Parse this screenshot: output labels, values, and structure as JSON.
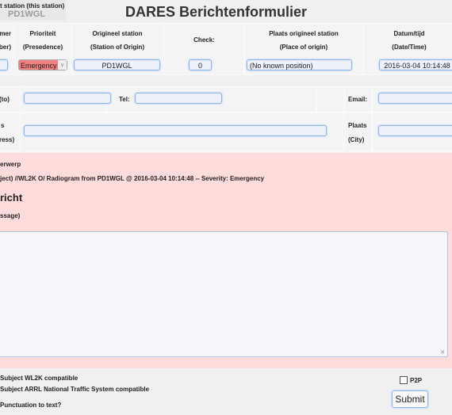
{
  "header": {
    "station_label": "t station (this station)",
    "station_value": "PD1WGL",
    "title": "DARES Berichtenformulier"
  },
  "columns": [
    {
      "l1": "mer",
      "l2": "ber)"
    },
    {
      "l1": "Prioriteit",
      "l2": "(Presedence)"
    },
    {
      "l1": "Origineel station",
      "l2": "(Station of Origin)"
    },
    {
      "l1": "Check:",
      "l2": ""
    },
    {
      "l1": "Plaats origineel station",
      "l2": "(Place of origin)"
    },
    {
      "l1": "Datum/tijd",
      "l2": "(Date/Time)"
    }
  ],
  "values": {
    "number": "",
    "priority": "Emergency",
    "origin": "PD1WGL",
    "check": "0",
    "place": "(No known position)",
    "datetime": "2016-03-04 10:14:48"
  },
  "colors": {
    "priority_bg": "#f08080",
    "pink": "#ffdcdc"
  },
  "recipient": {
    "to_label": "(to)",
    "tel_label": "Tel:",
    "email_label": "Email:",
    "address_l1": "s",
    "address_l2": "ress)",
    "city_l1": "Plaats",
    "city_l2": "(City)"
  },
  "message": {
    "subject_heading": "erwerp",
    "subject_line": "ject) //WL2K O/ Radiogram from PD1WGL @ 2016-03-04 10:14:48 -- Severity: Emergency",
    "bericht": "richt",
    "message_label": "ssage)",
    "body": ""
  },
  "footer": {
    "opt1": "Subject WL2K compatible",
    "opt2": "Subject ARRL National Traffic System compatible",
    "opt3": "Punctuation to text?",
    "p2p": "P2P",
    "submit": "Submit"
  }
}
